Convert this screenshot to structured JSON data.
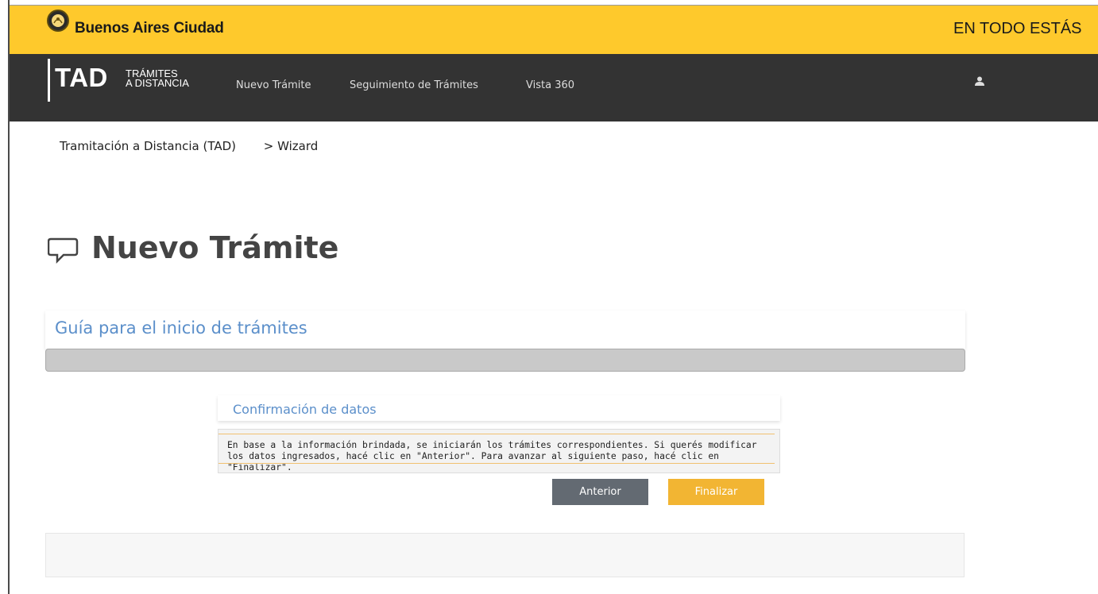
{
  "header": {
    "brand": "Buenos Aires Ciudad",
    "slogan": "EN TODO ESTÁS",
    "brand_color": "#fec92c"
  },
  "nav": {
    "logo_big": "TAD",
    "logo_small_line1": "TRÁMITES",
    "logo_small_line2": "A DISTANCIA",
    "links": [
      "Nuevo Trámite",
      "Seguimiento de Trámites",
      "Vista 360"
    ],
    "user_icon": "user-icon"
  },
  "breadcrumb": {
    "items": [
      "Tramitación a Distancia (TAD)",
      "> Wizard"
    ]
  },
  "page": {
    "title": "Nuevo Trámite",
    "title_icon": "chat-bubble-icon"
  },
  "guide": {
    "title": "Guía para el inicio de trámites"
  },
  "confirm": {
    "title": "Confirmación de datos",
    "message": "En base a la información brindada, se iniciarán los trámites correspondientes. Si querés modificar los datos ingresados, hacé clic en \"Anterior\". Para avanzar al siguiente paso, hacé clic en \"Finalizar\"."
  },
  "buttons": {
    "prev_label": "Anterior",
    "finish_label": "Finalizar"
  }
}
